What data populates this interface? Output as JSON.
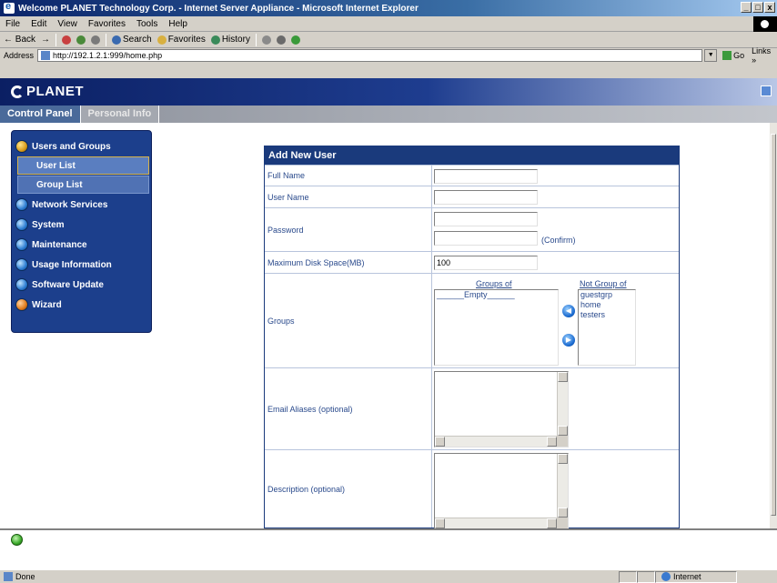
{
  "window": {
    "title": "Welcome PLANET Technology Corp. - Internet Server Appliance - Microsoft Internet Explorer",
    "controls": [
      "_",
      "□",
      "x"
    ]
  },
  "menubar": [
    "File",
    "Edit",
    "View",
    "Favorites",
    "Tools",
    "Help"
  ],
  "toolbar": {
    "back": "← Back",
    "forward": "→",
    "search": "Search",
    "favorites": "Favorites",
    "history": "History"
  },
  "addressbar": {
    "label": "Address",
    "url": "http://192.1.2.1:999/home.php",
    "go": "Go",
    "links": "Links »"
  },
  "brand": {
    "logo_text": "PLANET"
  },
  "tabs": [
    {
      "label": "Control Panel",
      "active": true
    },
    {
      "label": "Personal Info",
      "active": false
    }
  ],
  "sidebar": {
    "items": [
      {
        "label": "Users and Groups",
        "icon": "users-groups-icon"
      },
      {
        "label": "User List",
        "sub": true,
        "selected": true
      },
      {
        "label": "Group List",
        "sub": true,
        "selected": false
      },
      {
        "label": "Network Services",
        "icon": "network-icon"
      },
      {
        "label": "System",
        "icon": "system-icon"
      },
      {
        "label": "Maintenance",
        "icon": "maintenance-icon"
      },
      {
        "label": "Usage Information",
        "icon": "usage-icon"
      },
      {
        "label": "Software Update",
        "icon": "update-icon"
      },
      {
        "label": "Wizard",
        "icon": "wizard-icon"
      }
    ]
  },
  "form": {
    "title": "Add New User",
    "full_name_label": "Full Name",
    "full_name_value": "",
    "user_name_label": "User Name",
    "user_name_value": "",
    "password_label": "Password",
    "confirm_label": "(Confirm)",
    "disk_label": "Maximum Disk Space(MB)",
    "disk_value": "100",
    "groups_label": "Groups",
    "groups_of_caption": "Groups of",
    "groups_of_items": [
      "______Empty______"
    ],
    "not_group_caption": "Not Group of",
    "not_group_items": [
      "guestgrp",
      "home",
      "testers"
    ],
    "add_arrow": "◀",
    "remove_arrow": "▶",
    "email_label": "Email Aliases (optional)",
    "description_label": "Description (optional)"
  },
  "statusbar": {
    "status": "Done",
    "zone": "Internet"
  },
  "colors": {
    "brand_navy": "#1a3a7c",
    "sidebar_blue": "#1c3f8c",
    "label_blue": "#2a4a8c"
  }
}
